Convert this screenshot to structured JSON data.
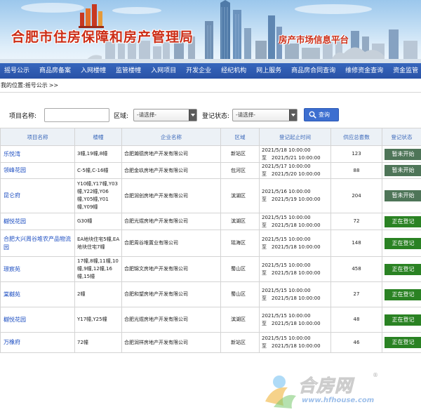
{
  "header": {
    "title": "合肥市住房保障和房产管理局",
    "subtitle": "房产市场信息平台"
  },
  "nav": {
    "items": [
      "摇号公示",
      "商品房备案",
      "入网楼幢",
      "监管楼幢",
      "入网项目",
      "开发企业",
      "经纪机构",
      "网上服务",
      "商品房合同查询",
      "维修资金查询",
      "资金监管"
    ]
  },
  "breadcrumb": {
    "prefix": "我的位置:",
    "current": "摇号公示",
    "separator": ">>"
  },
  "search": {
    "project_label": "项目名称:",
    "project_value": "",
    "district_label": "区域:",
    "district_value": "-请选择-",
    "status_label": "登记状态:",
    "status_value": "-请选择-",
    "button_label": "查询"
  },
  "table": {
    "headers": [
      "项目名称",
      "楼幢",
      "企业名称",
      "区域",
      "登记起止时间",
      "供应总套数",
      "登记状态"
    ],
    "to_label": "至",
    "rows": [
      {
        "name": "乐悦湾",
        "buildings": "3幢,19幢,8幢",
        "company": "合肥瀚德房地产开发有限公司",
        "district": "新站区",
        "start": "2021/5/18 10:00:00",
        "end": "2021/5/21 10:00:00",
        "count": "123",
        "status": "暂未开始"
      },
      {
        "name": "领峰花园",
        "buildings": "C-5幢,C-16幢",
        "company": "合肥金玖房地产开发有限公司",
        "district": "包河区",
        "start": "2021/5/17 10:00:00",
        "end": "2021/5/20 10:00:00",
        "count": "88",
        "status": "暂未开始"
      },
      {
        "name": "昆仑府",
        "buildings": "Y10幢,Y17幢,Y03幢,Y22幢,Y06幢,Y05幢,Y01幢,Y09幢",
        "company": "合肥润创房地产开发有限公司",
        "district": "滨湖区",
        "start": "2021/5/16 10:00:00",
        "end": "2021/5/19 10:00:00",
        "count": "204",
        "status": "暂未开始"
      },
      {
        "name": "樾悦花园",
        "buildings": "G30幢",
        "company": "合肥光煜房地产开发有限公司",
        "district": "滨湖区",
        "start": "2021/5/15 10:00:00",
        "end": "2021/5/18 10:00:00",
        "count": "72",
        "status": "正在登记"
      },
      {
        "name": "合肥大兴周谷堆农产品物流园",
        "buildings": "EA地块住宅5幢,EA地块住宅7幢",
        "company": "合肥周谷堆置业有限公司",
        "district": "瑶海区",
        "start": "2021/5/15 10:00:00",
        "end": "2021/5/18 10:00:00",
        "count": "148",
        "status": "正在登记"
      },
      {
        "name": "璟宸苑",
        "buildings": "17幢,8幢,11幢,10幢,9幢,12幢,16幢,15幢",
        "company": "合肥锦文房地产开发有限公司",
        "district": "蜀山区",
        "start": "2021/5/15 10:00:00",
        "end": "2021/5/18 10:00:00",
        "count": "458",
        "status": "正在登记"
      },
      {
        "name": "棠樾苑",
        "buildings": "2幢",
        "company": "合肥和望房地产开发有限公司",
        "district": "蜀山区",
        "start": "2021/5/15 10:00:00",
        "end": "2021/5/18 10:00:00",
        "count": "27",
        "status": "正在登记"
      },
      {
        "name": "樾悦花园",
        "buildings": "Y17幢,Y25幢",
        "company": "合肥光煜房地产开发有限公司",
        "district": "滨湖区",
        "start": "2021/5/15 10:00:00",
        "end": "2021/5/18 10:00:00",
        "count": "48",
        "status": "正在登记"
      },
      {
        "name": "万橡府",
        "buildings": "72幢",
        "company": "合肥润祥房地产开发有限公司",
        "district": "新站区",
        "start": "2021/5/15 10:00:00",
        "end": "2021/5/18 10:00:00",
        "count": "46",
        "status": "正在登记"
      }
    ]
  },
  "watermark": {
    "text": "合房网",
    "url": "www.hfhouse.com"
  },
  "colors": {
    "nav_bg": "#2f5db2",
    "title_red": "#cc2d16",
    "link_blue": "#1e4fc2",
    "status_pending": "#4e7558",
    "status_active": "#2a8223",
    "header_bg": "#ecf1f6"
  }
}
